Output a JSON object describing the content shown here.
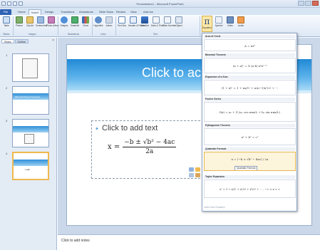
{
  "window": {
    "title": "Presentation1 - Microsoft PowerPoint"
  },
  "tabs": [
    "File",
    "Home",
    "Insert",
    "Design",
    "Transitions",
    "Animations",
    "Slide Show",
    "Review",
    "View",
    "Add-Ins"
  ],
  "active_tab": "Insert",
  "ribbon": {
    "buttons": [
      {
        "label": "Table"
      },
      {
        "label": "Picture"
      },
      {
        "label": "Clip Art"
      },
      {
        "label": "Screenshot"
      },
      {
        "label": "Photo Album"
      },
      {
        "label": "Shapes"
      },
      {
        "label": "SmartArt"
      },
      {
        "label": "Chart"
      },
      {
        "label": "Hyperlink"
      },
      {
        "label": "Action"
      },
      {
        "label": "Text Box"
      },
      {
        "label": "Header & Footer"
      },
      {
        "label": "WordArt"
      },
      {
        "label": "Date & Time"
      },
      {
        "label": "Slide Number"
      },
      {
        "label": "Object"
      }
    ],
    "equation_label": "Equation",
    "extra_buttons": [
      {
        "label": "Symbol"
      },
      {
        "label": "Video"
      },
      {
        "label": "Audio"
      }
    ],
    "groups": [
      "Tables",
      "Images",
      "Illustrations",
      "Links",
      "Text"
    ]
  },
  "left_pane": {
    "tabs": [
      "Slides",
      "Outline"
    ],
    "close_glyph": "×",
    "thumbnails": [
      {
        "num": "1",
        "text": ""
      },
      {
        "num": "2",
        "text": "Microsoft Power Presenter"
      },
      {
        "num": "3",
        "text": ""
      },
      {
        "num": "4",
        "text": "...Light"
      }
    ]
  },
  "slide": {
    "title_placeholder": "Click to ac",
    "body_placeholder": "Click to add text",
    "formula": {
      "lhs": "x =",
      "numerator": "−b ± √b² − 4ac",
      "denominator": "2a"
    }
  },
  "notes_placeholder": "Click to add notes",
  "equation_gallery": {
    "items": [
      {
        "title": "Area of Circle",
        "formula": "A = πr²"
      },
      {
        "title": "Binomial Theorem",
        "formula": "(x + a)ⁿ = Σ (n k) xᵏaⁿ⁻ᵏ"
      },
      {
        "title": "Expansion of a Sum",
        "formula": "(1 + x)ⁿ = 1 + nx/1! + n(n−1)x²/2! + ⋯"
      },
      {
        "title": "Fourier Series",
        "formula": "f(x) = a₀ + Σ (aₙ cos nπx/L + bₙ sin nπx/L)"
      },
      {
        "title": "Pythagorean Theorem",
        "formula": "a² + b² = c²"
      },
      {
        "title": "Quadratic Formula",
        "formula": "x = (−b ± √b² − 4ac) / 2a"
      },
      {
        "title": "Taylor Expansion",
        "formula": "eˣ = 1 + x/1! + x²/2! + x³/3! + ⋯ ,  −∞ < x < ∞"
      }
    ],
    "tooltip": "Quadratic Formula",
    "footer": "Insert New Equation"
  },
  "colors": {
    "accent": "#2e62b4",
    "slide_band": "#2189d6",
    "highlight": "#fbe8a8"
  }
}
